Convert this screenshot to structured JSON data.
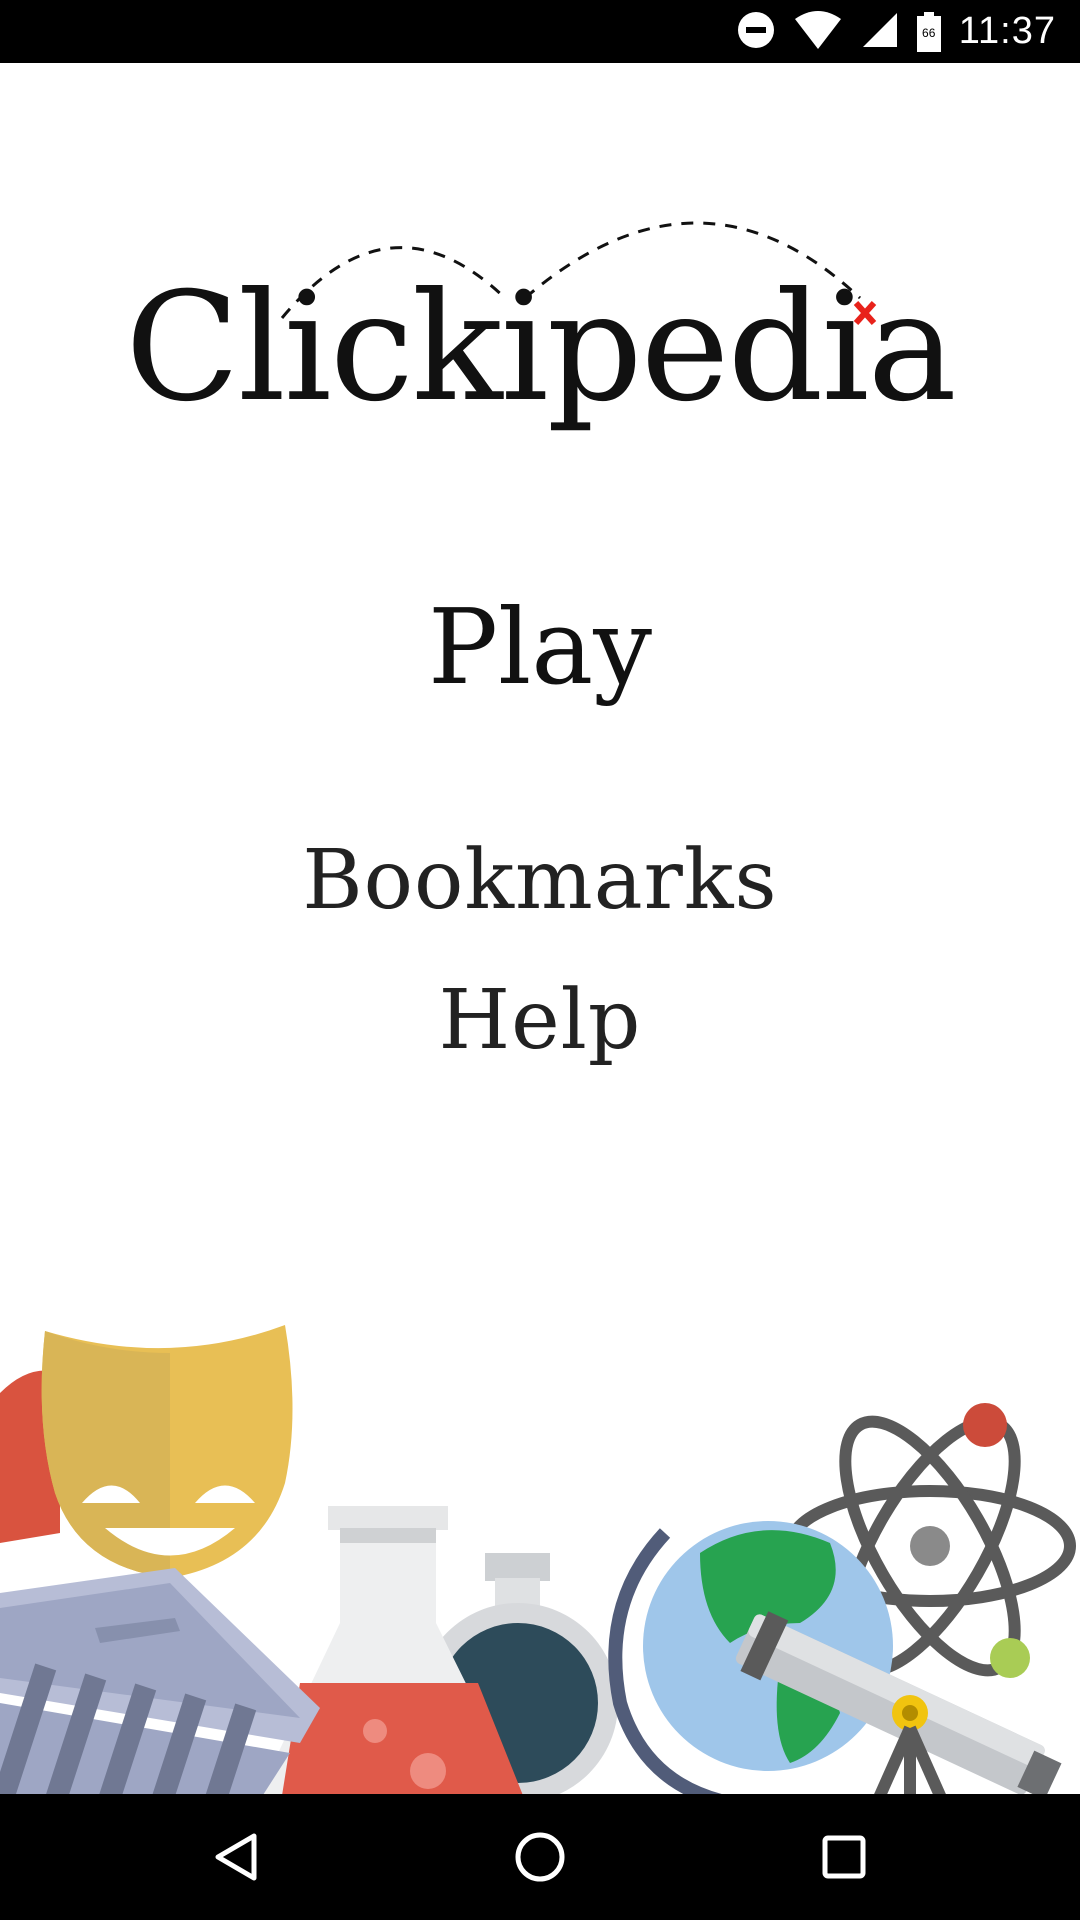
{
  "status_bar": {
    "time": "11:37",
    "battery_level": "66",
    "icons": [
      "do-not-disturb-icon",
      "wifi-icon",
      "signal-icon",
      "battery-icon"
    ]
  },
  "logo": {
    "text": "Clickipedia",
    "accent_color": "#e8221b"
  },
  "menu": {
    "play": "Play",
    "bookmarks": "Bookmarks",
    "help": "Help"
  },
  "illustration": {
    "items": [
      "theater-masks-icon",
      "museum-icon",
      "erlenmeyer-flask-icon",
      "round-flask-icon",
      "globe-icon",
      "atom-icon",
      "telescope-icon"
    ],
    "colors": {
      "mask_gold": "#e8bf55",
      "mask_red": "#d9533f",
      "museum": "#9ea6c4",
      "flask_liquid": "#e05a4a",
      "round_flask_liquid": "#2d4b5a",
      "globe_water": "#9fc6ea",
      "globe_land": "#27a350",
      "atom": "#5a5a5a",
      "atom_red": "#cc4b3a",
      "atom_green": "#a9cc55"
    }
  },
  "nav_bar": {
    "buttons": [
      "back-icon",
      "home-icon",
      "recents-icon"
    ]
  }
}
